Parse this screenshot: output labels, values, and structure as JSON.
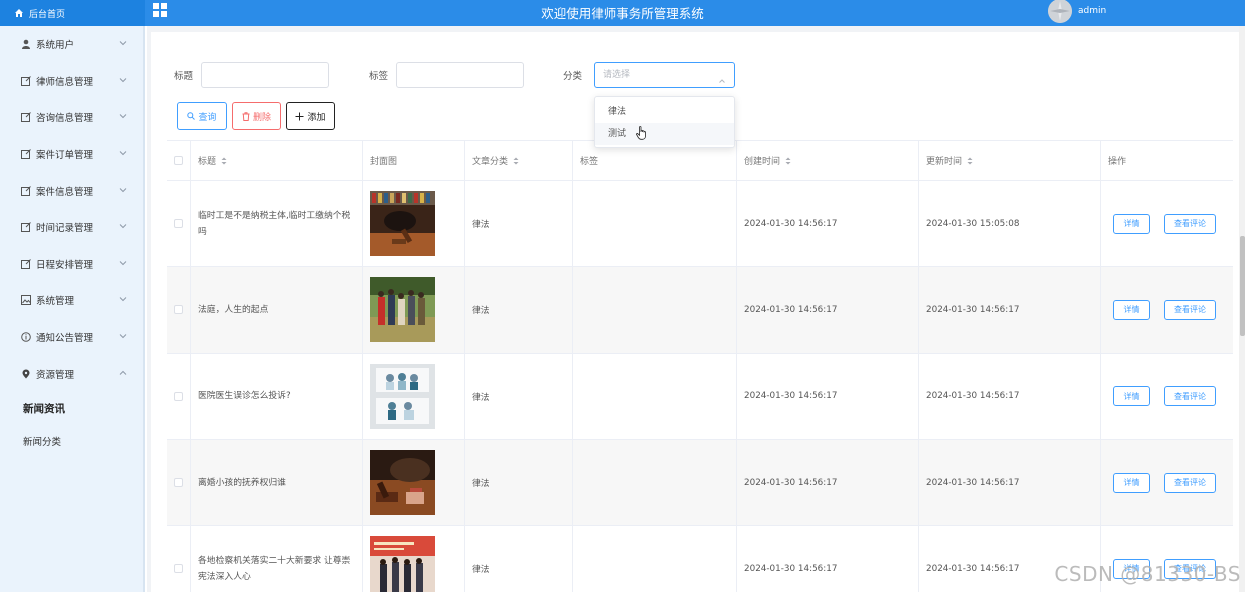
{
  "header": {
    "brand_label": "后台首页",
    "title": "欢迎使用律师事务所管理系统",
    "username": "admin",
    "bar_color": "#2b8ce8"
  },
  "sidebar": {
    "items": [
      {
        "label": "系统用户",
        "icon": "user-icon"
      },
      {
        "label": "律师信息管理",
        "icon": "edit-icon"
      },
      {
        "label": "咨询信息管理",
        "icon": "edit-icon"
      },
      {
        "label": "案件订单管理",
        "icon": "edit-icon"
      },
      {
        "label": "案件信息管理",
        "icon": "edit-icon"
      },
      {
        "label": "时间记录管理",
        "icon": "edit-icon"
      },
      {
        "label": "日程安排管理",
        "icon": "edit-icon"
      },
      {
        "label": "系统管理",
        "icon": "picture-icon"
      },
      {
        "label": "通知公告管理",
        "icon": "info-icon"
      },
      {
        "label": "资源管理",
        "icon": "location-icon"
      }
    ],
    "sub_items": [
      {
        "label": "新闻资讯",
        "active": true
      },
      {
        "label": "新闻分类",
        "active": false
      }
    ]
  },
  "filters": {
    "title_label": "标题",
    "title_value": "",
    "tag_label": "标签",
    "tag_value": "",
    "category_label": "分类",
    "category_placeholder": "请选择",
    "category_options": [
      "律法",
      "测试"
    ]
  },
  "toolbar": {
    "query_label": "查询",
    "delete_label": "删除",
    "add_label": "添加"
  },
  "table": {
    "columns": [
      "标题",
      "封面图",
      "文章分类",
      "标签",
      "创建时间",
      "更新时间",
      "操作"
    ],
    "rows": [
      {
        "title": "临时工是不是纳税主体,临时工缴纳个税吗",
        "category": "律法",
        "tags": "",
        "created": "2024-01-30 14:56:17",
        "updated": "2024-01-30 15:05:08"
      },
      {
        "title": "法庭，人生的起点",
        "category": "律法",
        "tags": "",
        "created": "2024-01-30 14:56:17",
        "updated": "2024-01-30 14:56:17"
      },
      {
        "title": "医院医生误诊怎么投诉?",
        "category": "律法",
        "tags": "",
        "created": "2024-01-30 14:56:17",
        "updated": "2024-01-30 14:56:17"
      },
      {
        "title": "离婚小孩的抚养权归谁",
        "category": "律法",
        "tags": "",
        "created": "2024-01-30 14:56:17",
        "updated": "2024-01-30 14:56:17"
      },
      {
        "title": "各地检察机关落实二十大新要求 让尊崇宪法深入人心",
        "category": "律法",
        "tags": "",
        "created": "2024-01-30 14:56:17",
        "updated": "2024-01-30 14:56:17"
      }
    ],
    "detail_label": "详情",
    "comment_label": "查看评论"
  },
  "watermark": "CSDN @81330-BS"
}
